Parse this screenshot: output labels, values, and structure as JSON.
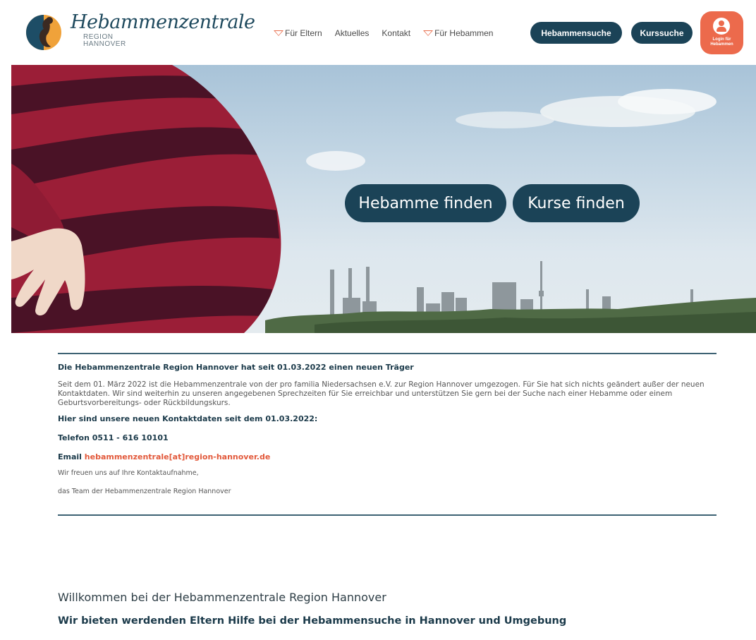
{
  "logo": {
    "script_text": "Hebammenzentrale",
    "sub_line1": "REGION",
    "sub_line2": "HANNOVER"
  },
  "nav": {
    "items": [
      {
        "label": "Für Eltern",
        "has_dropdown": true
      },
      {
        "label": "Aktuelles",
        "has_dropdown": false
      },
      {
        "label": "Kontakt",
        "has_dropdown": false
      },
      {
        "label": "Für Hebammen",
        "has_dropdown": true
      }
    ],
    "hebammensuche_label": "Hebammensuche",
    "kurssuche_label": "Kurssuche",
    "login_line1": "Login für",
    "login_line2": "Hebammen"
  },
  "hero": {
    "find_midwife_label": "Hebamme finden",
    "find_courses_label": "Kurse finden"
  },
  "news": {
    "title": "Die Hebammenzentrale Region Hannover hat seit 01.03.2022 einen neuen Träger",
    "body": "Seit dem 01. März 2022 ist die Hebammenzentrale von der pro familia Niedersachsen e.V. zur Region Hannover umgezogen. Für Sie hat sich nichts geändert außer der neuen Kontaktdaten. Wir sind weiterhin zu unseren angegebenen Sprechzeiten für Sie erreichbar und unterstützen Sie gern bei der Suche nach einer Hebamme oder einem Geburtsvorbereitungs- oder Rückbildungskurs.",
    "contact_heading": "Hier sind unsere neuen Kontaktdaten seit dem 01.03.2022:",
    "phone": "Telefon 0511 - 616 10101",
    "email_prefix": "Email ",
    "email": "hebammenzentrale[at]region-hannover.de",
    "closing": "Wir freuen uns auf Ihre Kontaktaufnahme,",
    "signature": "das Team der Hebammenzentrale Region Hannover"
  },
  "welcome": {
    "heading": "Willkommen bei der Hebammenzentrale Region Hannover",
    "subheading": "Wir bieten werdenden Eltern Hilfe bei der Hebammensuche in Hannover und Umgebung"
  },
  "colors": {
    "primary_dark": "#1b4357",
    "accent_orange": "#ec6a4c",
    "link_red": "#e2593b"
  }
}
